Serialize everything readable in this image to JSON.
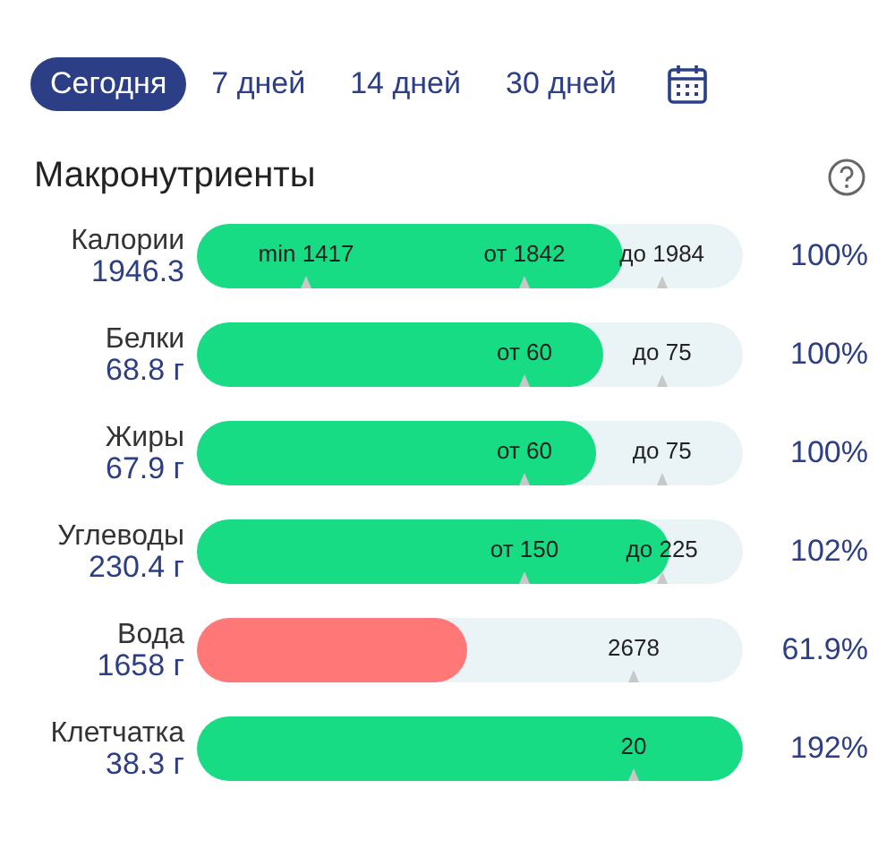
{
  "tabs": [
    {
      "label": "Сегодня",
      "selected": true
    },
    {
      "label": "7 дней",
      "selected": false
    },
    {
      "label": "14 дней",
      "selected": false
    },
    {
      "label": "30 дней",
      "selected": false
    }
  ],
  "section": {
    "title": "Макронутриенты"
  },
  "nutrients": [
    {
      "name": "Калории",
      "amount": "1946.3",
      "level": 0.78,
      "color": "#18dc84",
      "percent": "100%",
      "marks": [
        {
          "label": "min 1417",
          "level": 0.2
        },
        {
          "label": "от 1842",
          "level": 0.6
        },
        {
          "label": "до 1984",
          "level": 0.852
        }
      ]
    },
    {
      "name": "Белки",
      "amount": "68.8 г",
      "level": 0.744,
      "color": "#18dc84",
      "percent": "100%",
      "marks": [
        {
          "label": "от 60",
          "level": 0.6
        },
        {
          "label": "до 75",
          "level": 0.852
        }
      ]
    },
    {
      "name": "Жиры",
      "amount": "67.9 г",
      "level": 0.73,
      "color": "#18dc84",
      "percent": "100%",
      "marks": [
        {
          "label": "от 60",
          "level": 0.6
        },
        {
          "label": "до 75",
          "level": 0.852
        }
      ]
    },
    {
      "name": "Углеводы",
      "amount": "230.4 г",
      "level": 0.866,
      "color": "#18dc84",
      "percent": "102%",
      "marks": [
        {
          "label": "от 150",
          "level": 0.6
        },
        {
          "label": "до 225",
          "level": 0.852
        }
      ]
    },
    {
      "name": "Вода",
      "amount": "1658 г",
      "level": 0.495,
      "color": "#ff7777",
      "percent": "61.9%",
      "marks": [
        {
          "label": "2678",
          "level": 0.8
        }
      ]
    },
    {
      "name": "Клетчатка",
      "amount": "38.3 г",
      "level": 1,
      "color": "#18dc84",
      "percent": "192%",
      "marks": [
        {
          "label": "20",
          "level": 0.8
        }
      ]
    }
  ]
}
